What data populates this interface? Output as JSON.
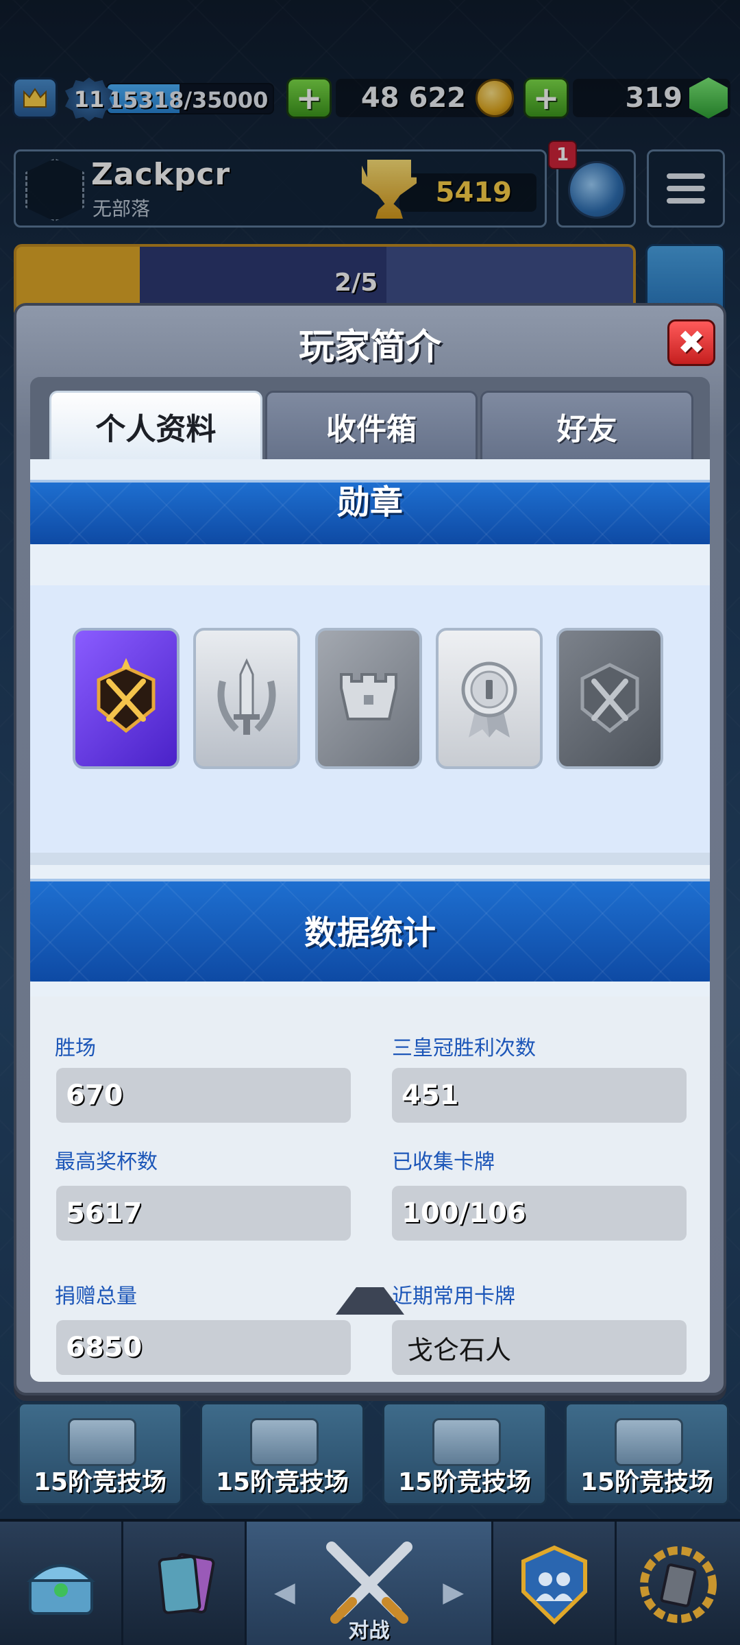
{
  "header": {
    "level": "11",
    "xp_text": "15318/35000",
    "xp_progress": 0.4376,
    "gold": "48 622",
    "gems": "319"
  },
  "profile": {
    "player_name": "Zackpcr",
    "clan_name": "无部落",
    "trophies": "5419",
    "notification_count": "1"
  },
  "banner": {
    "progress": "2/5"
  },
  "modal": {
    "title": "玩家简介",
    "close_symbol": "✖",
    "tabs": [
      "个人资料",
      "收件箱",
      "好友"
    ],
    "active_tab": 0,
    "badges_title": "勋章",
    "stats_title": "数据统计",
    "stats": [
      {
        "label": "胜场",
        "value": "670"
      },
      {
        "label": "三皇冠胜利次数",
        "value": "451"
      },
      {
        "label": "最高奖杯数",
        "value": "5617"
      },
      {
        "label": "已收集卡牌",
        "value": "100/106"
      },
      {
        "label": "捐赠总量",
        "value": "6850"
      },
      {
        "label": "近期常用卡牌",
        "value": "戈仑石人"
      }
    ]
  },
  "chests": [
    "15阶竞技场",
    "15阶竞技场",
    "15阶竞技场",
    "15阶竞技场"
  ],
  "bottom_nav": {
    "battle_label": "对战"
  },
  "colors": {
    "accent_blue": "#1c56b8",
    "section_blue": "#1e6fd0",
    "badge_purple": "#6a3cf0",
    "close_red": "#d62828",
    "plus_green": "#5ec02e"
  }
}
